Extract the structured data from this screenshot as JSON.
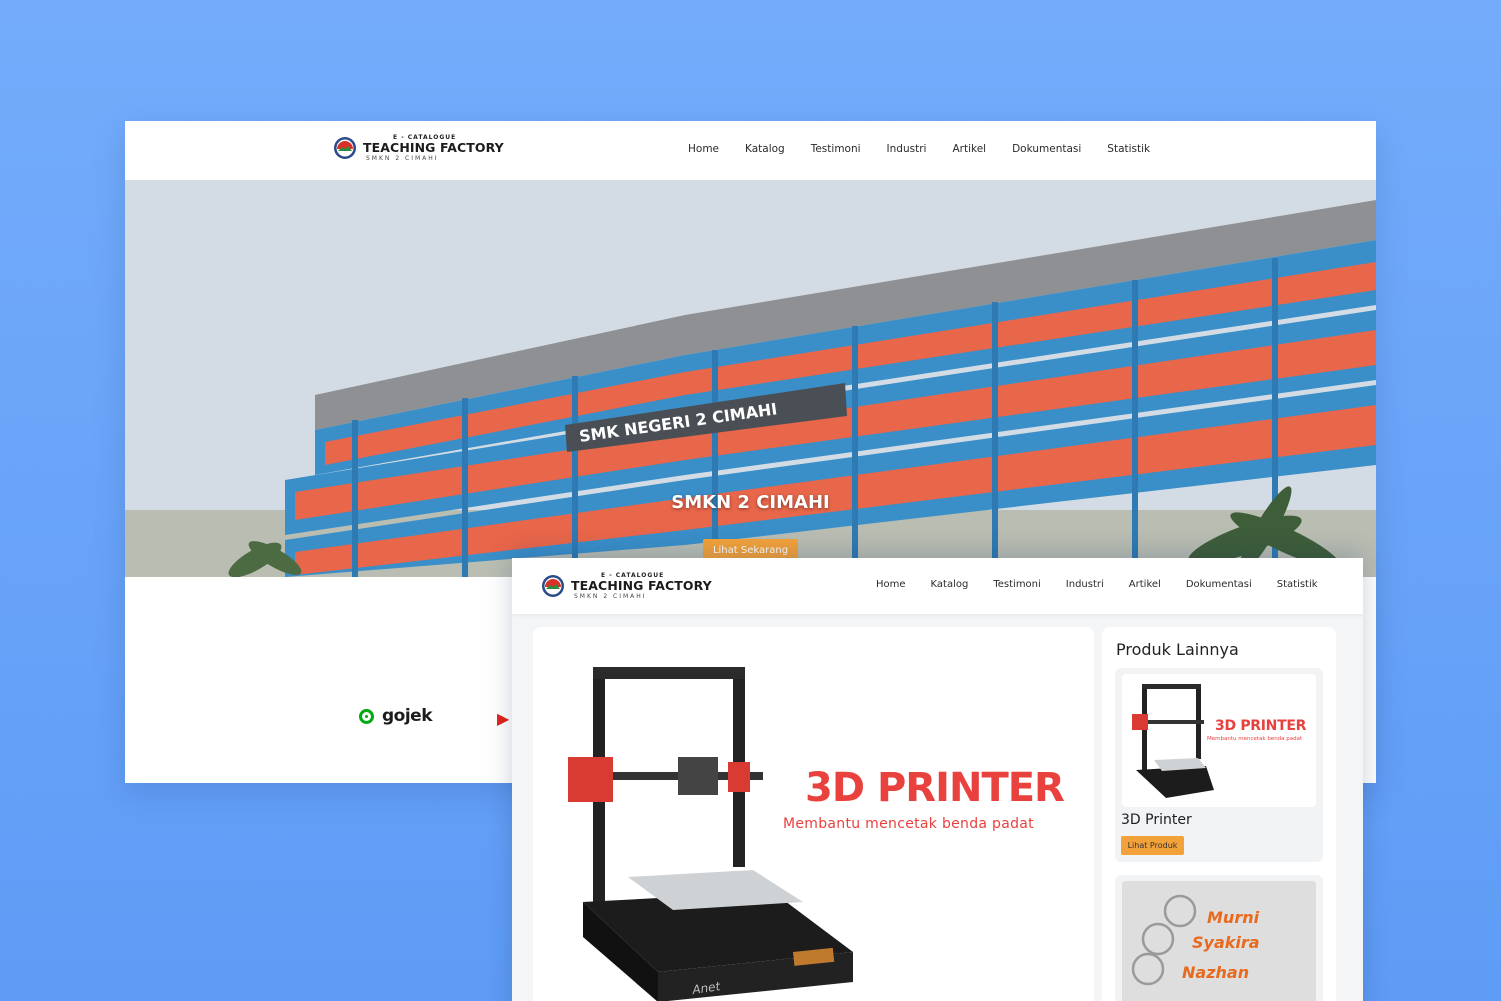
{
  "brand": {
    "tagline": "E - CATALOGUE",
    "name": "TEACHING FACTORY",
    "school": "SMKN 2 CIMAHI"
  },
  "nav": [
    "Home",
    "Katalog",
    "Testimoni",
    "Industri",
    "Artikel",
    "Dokumentasi",
    "Statistik"
  ],
  "hero": {
    "building_sign": "SMK NEGERI 2 CIMAHI",
    "title": "SMKN 2 CIMAHI",
    "cta": "Lihat Sekarang"
  },
  "partners": {
    "gojek": "gojek"
  },
  "product": {
    "banner_title": "3D PRINTER",
    "banner_subtitle": "Membantu mencetak benda padat",
    "printer_brand": "Anet"
  },
  "sidebar": {
    "title": "Produk Lainnya",
    "items": [
      {
        "image_title": "3D PRINTER",
        "image_subtitle": "Membantu mencetak benda padat",
        "name": "3D Printer",
        "button": "Lihat Produk"
      },
      {
        "keychain_names": [
          "Murni",
          "Syakira",
          "Nazhan"
        ]
      }
    ]
  },
  "colors": {
    "background": "#6aa5f9",
    "accent": "#f3a23a",
    "brand_red": "#e8413e",
    "building_blue": "#2f8fce",
    "building_orange": "#e8664a"
  }
}
